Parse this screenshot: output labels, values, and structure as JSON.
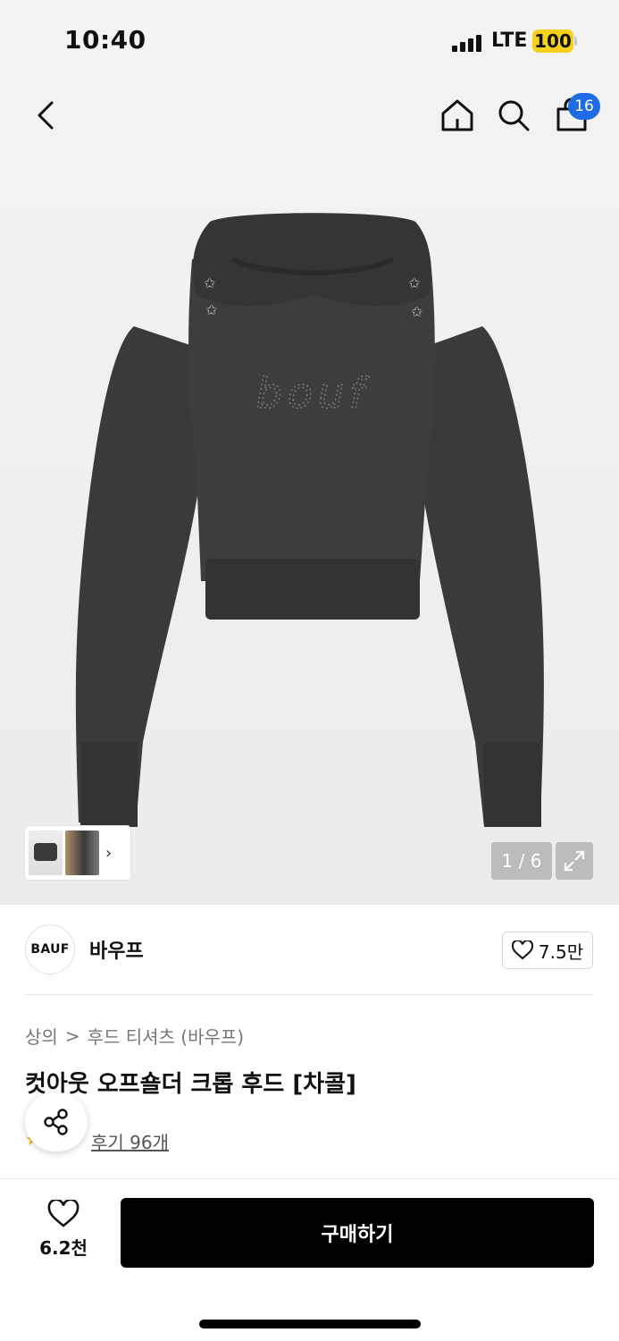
{
  "status_bar": {
    "time": "10:40",
    "network": "LTE",
    "battery": "100"
  },
  "nav": {
    "cart_count": "16",
    "back_icon": "chevron-left-icon",
    "home_icon": "home-icon",
    "search_icon": "search-icon",
    "cart_icon": "shopping-bag-icon"
  },
  "gallery": {
    "counter": "1 / 6",
    "logo_text": "bouf"
  },
  "brand": {
    "logo": "BAUF",
    "name": "바우프",
    "likes": "7.5만"
  },
  "breadcrumb": {
    "category": "상의",
    "separator": ">",
    "subcategory": "후드 티셔츠 (바우프)"
  },
  "product": {
    "title": "컷아웃 오프숄더 크롭 후드 [차콜]"
  },
  "reviews": {
    "link_text": "후기 96개",
    "stars": "★★"
  },
  "bottom_bar": {
    "likes": "6.2천",
    "buy_label": "구매하기"
  },
  "colors": {
    "accent": "#1f6be6",
    "battery": "#f5d11c",
    "garment": "#3b3b3b"
  }
}
